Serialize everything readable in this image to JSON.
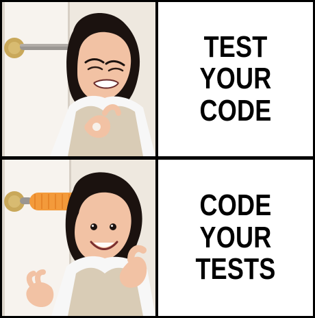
{
  "panels": {
    "top": {
      "left": {
        "type": "image",
        "icon": "girl-grimace-doorknob-icon"
      },
      "right": {
        "text": "TEST\nYOUR\nCODE"
      }
    },
    "bottom": {
      "left": {
        "type": "image",
        "icon": "girl-thumbs-up-doorknob-padded-icon"
      },
      "right": {
        "text": "CODE\nYOUR\nTESTS"
      }
    }
  },
  "colors": {
    "border": "#000000",
    "text": "#000000",
    "panel_bg": "#ffffff",
    "wall": "#eee8df",
    "door": "#f7f3ee",
    "brass": "#c9a85a",
    "padding_orange": "#f39a3b",
    "hair": "#1b120f",
    "skin": "#f2c2a4",
    "shirt": "#f7f7f7",
    "vest": "#d9ccb6"
  }
}
